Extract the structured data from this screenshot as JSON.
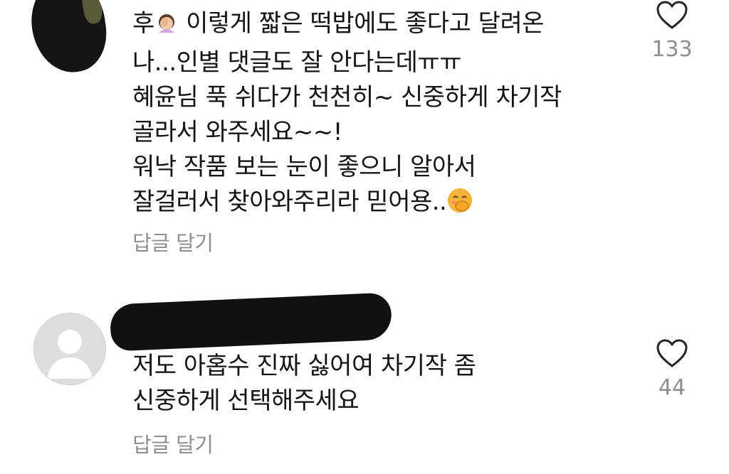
{
  "comments": [
    {
      "text_before_emoji": "후",
      "text_after_emoji": " 이렇게 짧은 떡밥에도 좋다고 달려온\n나...인별 댓글도 잘 안다는데ㅠㅠ\n혜윤님 푹 쉬다가 천천히~ 신중하게 차기작\n골라서 와주세요~~!\n워낙 작품 보는 눈이 좋으니 알아서\n잘걸러서 찾아와주리라 믿어용..",
      "emoji_1": "facepalm-emoji",
      "emoji_2": "hand-over-mouth-emoji",
      "reply_label": "답글 달기",
      "like_count": "133"
    },
    {
      "text": "저도 아홉수 진짜 싫어여 차기작 좀\n신중하게 선택해주세요",
      "reply_label": "답글 달기",
      "like_count": "44"
    }
  ],
  "colors": {
    "text": "#151515",
    "secondary": "#8e8e8e",
    "redaction": "#111111"
  }
}
